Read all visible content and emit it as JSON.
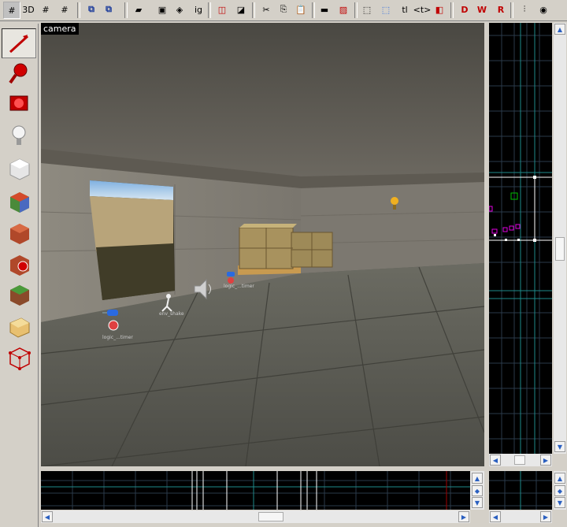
{
  "toolbar": {
    "buttons": [
      {
        "name": "grid-toggle-icon",
        "glyph": "#"
      },
      {
        "name": "grid-3d-icon",
        "glyph": "3D"
      },
      {
        "name": "grid-smaller-icon",
        "glyph": "#"
      },
      {
        "name": "grid-larger-icon",
        "glyph": "#"
      },
      {
        "name": "group-icon",
        "glyph": "⧉"
      },
      {
        "name": "ungroup-icon",
        "glyph": "⧉"
      },
      {
        "name": "carve-icon",
        "glyph": "▰"
      },
      {
        "name": "hollow-icon",
        "glyph": "▣"
      },
      {
        "name": "texture-lock-icon",
        "glyph": "◈"
      },
      {
        "name": "ignore-groups-label",
        "glyph": "ig"
      },
      {
        "name": "hide-items-icon",
        "glyph": "◫"
      },
      {
        "name": "show-items-icon",
        "glyph": "◪"
      },
      {
        "name": "cut-icon",
        "glyph": "✂"
      },
      {
        "name": "copy-icon",
        "glyph": "⎘"
      },
      {
        "name": "paste-icon",
        "glyph": "📋"
      },
      {
        "name": "solid-block-icon",
        "glyph": "▬"
      },
      {
        "name": "apply-texture-icon",
        "glyph": "▨"
      },
      {
        "name": "selection-bounds-icon",
        "glyph": "⬚"
      },
      {
        "name": "select-by-handles-icon",
        "glyph": "⬚"
      },
      {
        "name": "tl-label",
        "glyph": "tl"
      },
      {
        "name": "vertex-edit-icon",
        "glyph": "<t>"
      },
      {
        "name": "clip-icon",
        "glyph": "◧"
      },
      {
        "name": "entity-report-icon",
        "glyph": "D"
      },
      {
        "name": "check-problems-icon",
        "glyph": "W"
      },
      {
        "name": "map-info-icon",
        "glyph": "R"
      },
      {
        "name": "snap-icon",
        "glyph": "⫶"
      },
      {
        "name": "run-map-icon",
        "glyph": "◉"
      },
      {
        "name": "texture-browser-icon",
        "glyph": "▩"
      }
    ]
  },
  "toolbox": {
    "tools": [
      {
        "name": "selection-tool-icon",
        "active": true
      },
      {
        "name": "magnify-tool-icon",
        "active": false
      },
      {
        "name": "camera-tool-icon",
        "active": false
      },
      {
        "name": "entity-tool-icon",
        "active": false
      },
      {
        "name": "block-tool-icon",
        "active": false
      },
      {
        "name": "texture-application-icon",
        "active": false
      },
      {
        "name": "apply-current-texture-icon",
        "active": false
      },
      {
        "name": "decal-tool-icon",
        "active": false
      },
      {
        "name": "overlay-tool-icon",
        "active": false
      },
      {
        "name": "clipping-tool-icon",
        "active": false
      },
      {
        "name": "vertex-tool-icon",
        "active": false
      }
    ]
  },
  "viewport3d": {
    "label": "camera",
    "entities": [
      {
        "name": "logic-timer-entity",
        "label": "logic_...timer"
      },
      {
        "name": "env-shake-entity",
        "label": "env_shake"
      },
      {
        "name": "ambient-generic-entity",
        "label": ""
      },
      {
        "name": "logic-timer-entity-2",
        "label": "logic_...timer"
      }
    ]
  },
  "colors": {
    "grid_line": "#3a4a5a",
    "grid_major": "#1e8a8a",
    "brush_outline": "#ffffff",
    "entity_outline": "#e000e0",
    "selected_green": "#00c000"
  }
}
